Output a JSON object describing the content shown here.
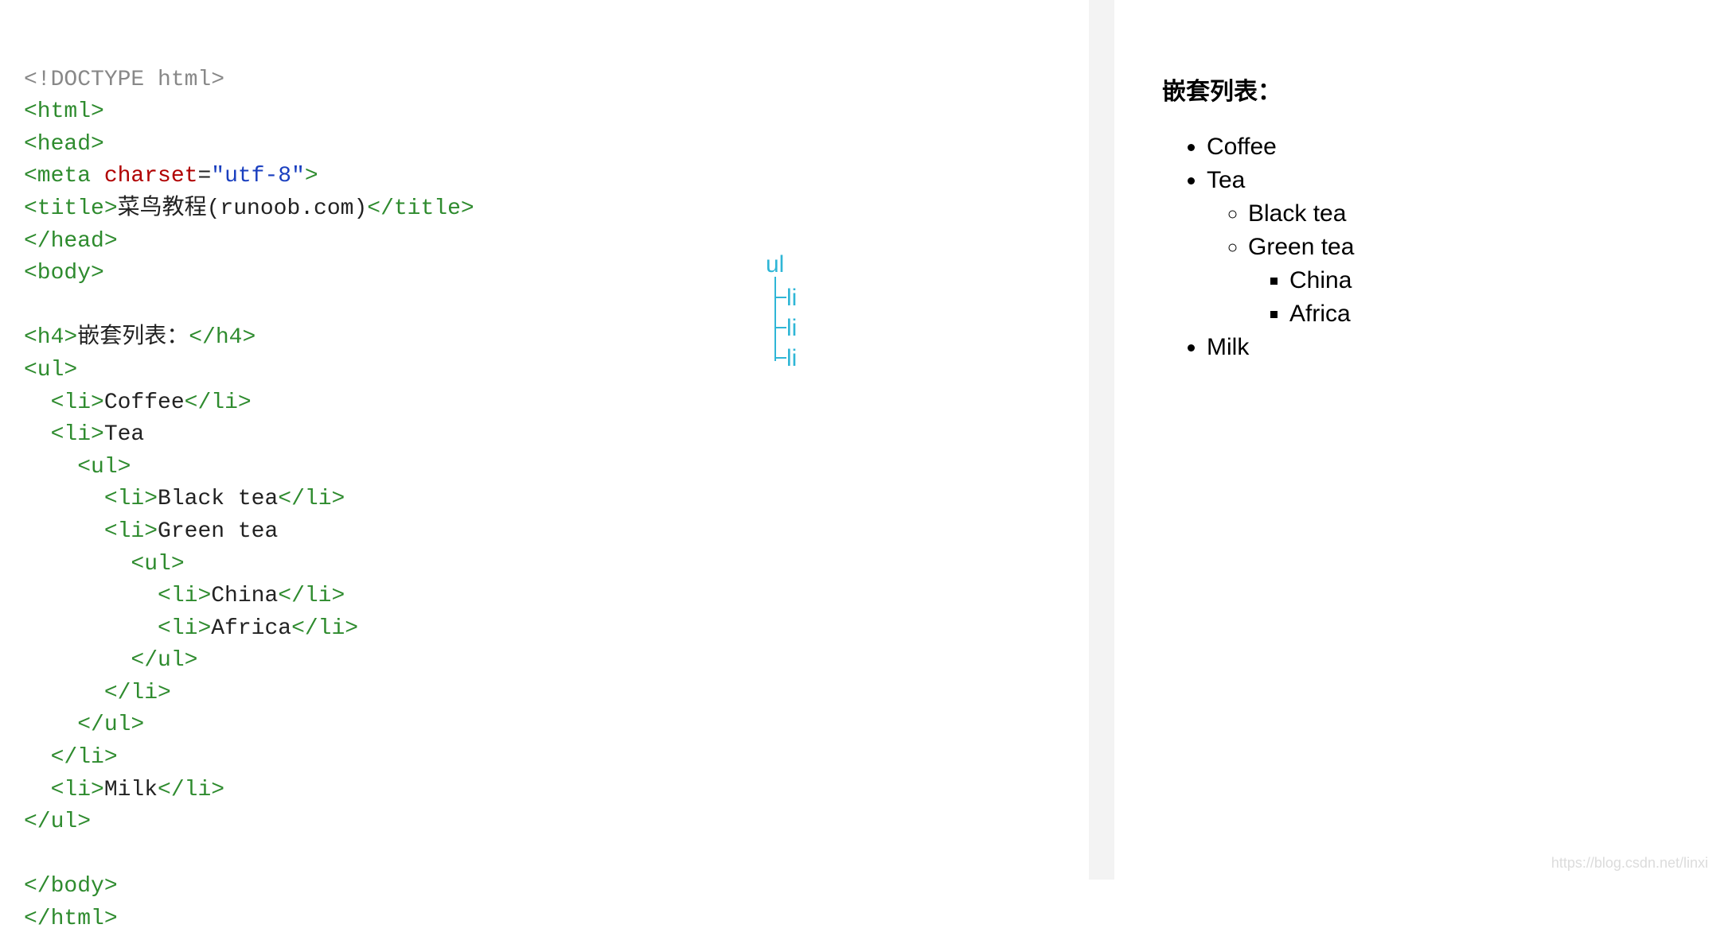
{
  "code": {
    "doctype": "<!DOCTYPE html>",
    "html_open": "<html>",
    "head_open": "<head>",
    "meta_open": "<meta",
    "meta_attr": "charset",
    "meta_eq": "=",
    "meta_val": "\"utf-8\"",
    "meta_close": ">",
    "title_open": "<title>",
    "title_text": "菜鸟教程(runoob.com)",
    "title_close": "</title>",
    "head_close": "</head>",
    "body_open": "<body>",
    "h4_open": "<h4>",
    "h4_text": "嵌套列表：",
    "h4_close": "</h4>",
    "ul_open": "<ul>",
    "li_open": "<li>",
    "li_close": "</li>",
    "coffee": "Coffee",
    "tea": "Tea",
    "black_tea": "Black tea",
    "green_tea": "Green tea",
    "china": "China",
    "africa": "Africa",
    "ul_close": "</ul>",
    "milk": "Milk",
    "body_close": "</body>",
    "html_close": "</html>"
  },
  "tree": {
    "root": "ul",
    "child1": "li",
    "child2": "li",
    "child3": "li"
  },
  "preview": {
    "heading": "嵌套列表：",
    "items": {
      "coffee": "Coffee",
      "tea": "Tea",
      "black_tea": "Black tea",
      "green_tea": "Green tea",
      "china": "China",
      "africa": "Africa",
      "milk": "Milk"
    }
  },
  "watermark": "https://blog.csdn.net/linxi"
}
